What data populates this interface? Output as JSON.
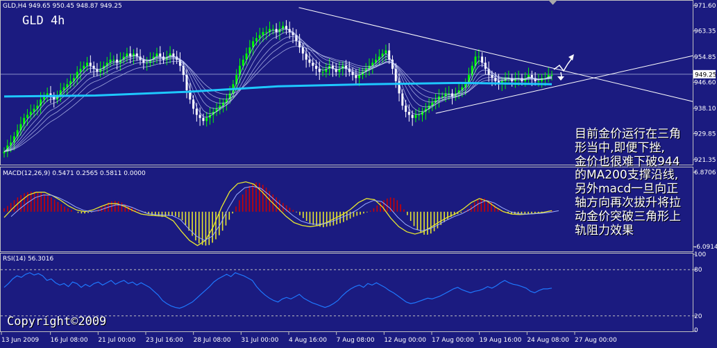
{
  "chart_title": "GLD 4h",
  "colors": {
    "background": "#1b1b80",
    "bull_candle": "#00ff00",
    "bear_candle": "#ffffff",
    "ma200": "#1ec8ff",
    "ma_ribbon": "#cfd8ff",
    "macd_positive": "#cc0000",
    "macd_negative": "#e8e830",
    "macd_signal": "#e8e830",
    "macd_line": "#9db0ff",
    "rsi_line": "#1e78ff",
    "trendline": "#ffffff"
  },
  "annotation_lines": [
    "目前金价运行在三角",
    "形当中,即便下挫,",
    "金价也很难下破944",
    "的MA200支撑沿线,",
    "另外macd一旦向正",
    "轴方向再次拔升将拉",
    "动金价突破三角形上",
    "轨阻力效果"
  ],
  "copyright": "Copyright©2009",
  "chart_data": [
    {
      "type": "candlestick",
      "header": "GLD,H4  949.65 950.45 948.87 949.25",
      "symbol": "GLD",
      "timeframe": "H4",
      "last_price": "949.25",
      "y_ticks": [
        "971.60",
        "963.35",
        "954.85",
        "946.60",
        "938.10",
        "929.85",
        "921.35"
      ],
      "ylim": [
        920.0,
        973.0
      ],
      "x_ticks": [
        "13 Jun 2009",
        "16 Jul 08:00",
        "21 Jul 00:00",
        "23 Jul 16:00",
        "28 Jul 08:00",
        "31 Jul 00:00",
        "4 Aug 16:00",
        "7 Aug 08:00",
        "12 Aug 00:00",
        "17 Aug 00:00",
        "19 Aug 16:00",
        "24 Aug 08:00",
        "27 Aug 00:00"
      ],
      "close": [
        924,
        926,
        927,
        929,
        931,
        933,
        935,
        936,
        937,
        938,
        939,
        941,
        942,
        943,
        942,
        941,
        942,
        944,
        945,
        946,
        947,
        948,
        950,
        951,
        952,
        953,
        952,
        951,
        950,
        951,
        952,
        953,
        954,
        954,
        953,
        954,
        955,
        956,
        955,
        956,
        955,
        954,
        953,
        953,
        954,
        955,
        956,
        955,
        954,
        955,
        956,
        955,
        954,
        952,
        949,
        944,
        941,
        938,
        936,
        935,
        934,
        935,
        936,
        937,
        938,
        939,
        940,
        941,
        943,
        946,
        949,
        952,
        954,
        956,
        958,
        960,
        961,
        962,
        963,
        963,
        964,
        964,
        963,
        964,
        965,
        964,
        963,
        962,
        960,
        958,
        956,
        954,
        953,
        952,
        951,
        950,
        950,
        951,
        952,
        951,
        950,
        951,
        952,
        951,
        950,
        949,
        948,
        949,
        950,
        951,
        952,
        953,
        954,
        955,
        956,
        957,
        954,
        951,
        947,
        943,
        939,
        937,
        936,
        935,
        936,
        936,
        937,
        938,
        939,
        940,
        941,
        942,
        942,
        943,
        943,
        942,
        943,
        944,
        945,
        946,
        949,
        952,
        955,
        955,
        953,
        951,
        949,
        948,
        947,
        946,
        947,
        948,
        948,
        947,
        948,
        948,
        947,
        948,
        949,
        948,
        947,
        947,
        948,
        948,
        949,
        949
      ],
      "series": [
        {
          "name": "MA200",
          "values": [
            942.0,
            942.3,
            943.5,
            945.3,
            946.0,
            946.4,
            946.0
          ]
        }
      ],
      "triangle_upper": {
        "from": [
          "4 Aug 16:00",
          971.0
        ],
        "to": [
          "27 Aug 00:00",
          949.7
        ]
      },
      "triangle_lower": {
        "from": [
          "17 Aug 00:00",
          936.5
        ],
        "to": [
          "27 Aug 00:00",
          946.5
        ]
      }
    },
    {
      "type": "bar",
      "header": "MACD(12,26,9) 0.5471 0.2565 0.5811 0.0000",
      "name": "MACD",
      "params": "12,26,9",
      "readings": [
        "0.5471",
        "0.2565",
        "0.5811",
        "0.0000"
      ],
      "y_ticks": [
        "6.8706",
        "-6.0914"
      ],
      "ylim": [
        -6.8,
        7.6
      ],
      "histogram": [
        0.6,
        1.0,
        1.5,
        2.0,
        2.5,
        2.9,
        3.2,
        3.4,
        3.5,
        3.5,
        3.4,
        3.3,
        3.1,
        2.9,
        2.5,
        2.1,
        1.7,
        1.3,
        0.9,
        0.6,
        0.3,
        0.0,
        -0.2,
        -0.3,
        -0.3,
        -0.2,
        -0.1,
        0.1,
        0.4,
        0.8,
        1.2,
        1.6,
        1.8,
        1.9,
        1.8,
        1.6,
        1.3,
        1.0,
        0.7,
        0.4,
        0.2,
        0.0,
        -0.2,
        -0.4,
        -0.6,
        -0.7,
        -0.8,
        -0.9,
        -0.8,
        -0.7,
        -0.7,
        -0.8,
        -1.0,
        -1.5,
        -2.3,
        -3.3,
        -4.2,
        -5.0,
        -5.5,
        -5.8,
        -5.9,
        -5.8,
        -5.4,
        -4.8,
        -4.1,
        -3.3,
        -2.4,
        -1.4,
        -0.3,
        0.9,
        2.0,
        3.0,
        3.9,
        4.5,
        4.9,
        5.1,
        5.0,
        4.7,
        4.2,
        3.6,
        3.0,
        2.5,
        2.0,
        1.5,
        1.1,
        0.7,
        0.3,
        -0.1,
        -0.6,
        -1.1,
        -1.6,
        -2.0,
        -2.3,
        -2.5,
        -2.6,
        -2.7,
        -2.6,
        -2.5,
        -2.4,
        -2.2,
        -2.0,
        -1.8,
        -1.5,
        -1.2,
        -0.9,
        -0.7,
        -0.5,
        -0.3,
        -0.1,
        0.2,
        0.6,
        1.1,
        1.6,
        2.0,
        2.3,
        2.5,
        2.4,
        2.0,
        1.3,
        0.4,
        -0.6,
        -1.6,
        -2.5,
        -3.2,
        -3.7,
        -4.0,
        -4.0,
        -3.8,
        -3.4,
        -2.9,
        -2.3,
        -1.8,
        -1.3,
        -0.9,
        -0.6,
        -0.4,
        -0.2,
        0.1,
        0.5,
        1.1,
        1.7,
        2.2,
        2.4,
        2.3,
        2.0,
        1.6,
        1.1,
        0.6,
        0.2,
        -0.1,
        -0.3,
        -0.4,
        -0.5,
        -0.5,
        -0.5,
        -0.4,
        -0.4,
        -0.3,
        -0.3,
        -0.2,
        -0.1,
        0.0,
        0.1,
        0.2
      ],
      "series": [
        {
          "name": "Signal",
          "values": [
            -1.0,
            0.5,
            1.8,
            2.9,
            3.4,
            3.4,
            2.8,
            2.0,
            1.0,
            0.3,
            0.0,
            0.3,
            0.9,
            1.4,
            1.4,
            0.9,
            0.2,
            -0.4,
            -0.6,
            -0.7,
            -0.8,
            -1.6,
            -3.4,
            -5.0,
            -5.9,
            -5.0,
            -2.5,
            0.8,
            3.5,
            4.9,
            5.2,
            4.8,
            3.5,
            2.0,
            0.6,
            -0.8,
            -1.9,
            -2.4,
            -2.6,
            -2.4,
            -1.9,
            -1.2,
            -0.5,
            0.4,
            1.6,
            2.3,
            2.1,
            0.8,
            -1.1,
            -2.6,
            -3.5,
            -3.9,
            -3.5,
            -2.7,
            -1.8,
            -1.0,
            -0.4,
            0.5,
            1.6,
            2.3,
            1.8,
            0.8,
            0.0,
            -0.4,
            -0.5,
            -0.4,
            -0.3,
            -0.1,
            0.2
          ]
        }
      ]
    },
    {
      "type": "line",
      "header": "RSI(14) 56.3016",
      "name": "RSI",
      "period": 14,
      "last_value": "56.3016",
      "y_ticks": [
        "100",
        "80",
        "20",
        "0"
      ],
      "ylim": [
        0,
        100
      ],
      "levels": [
        80,
        20
      ],
      "values": [
        57,
        62,
        68,
        72,
        70,
        74,
        76,
        73,
        75,
        72,
        66,
        68,
        63,
        60,
        62,
        58,
        64,
        62,
        57,
        61,
        58,
        62,
        64,
        60,
        63,
        66,
        61,
        64,
        66,
        62,
        64,
        60,
        63,
        60,
        57,
        52,
        47,
        40,
        36,
        33,
        31,
        30,
        32,
        35,
        38,
        43,
        48,
        53,
        58,
        64,
        68,
        71,
        74,
        71,
        76,
        74,
        72,
        69,
        66,
        58,
        52,
        47,
        43,
        40,
        38,
        42,
        44,
        42,
        45,
        48,
        43,
        40,
        37,
        35,
        33,
        31,
        33,
        36,
        40,
        46,
        51,
        55,
        58,
        60,
        57,
        62,
        60,
        63,
        60,
        57,
        53,
        50,
        46,
        42,
        38,
        36,
        37,
        39,
        41,
        43,
        42,
        44,
        46,
        49,
        52,
        55,
        57,
        54,
        52,
        50,
        52,
        53,
        55,
        58,
        56,
        59,
        63,
        66,
        63,
        61,
        60,
        58,
        56,
        52,
        50,
        53,
        55,
        55,
        56
      ]
    }
  ]
}
